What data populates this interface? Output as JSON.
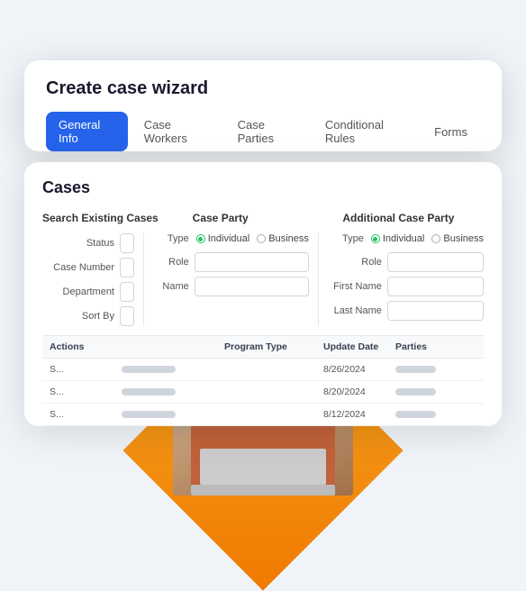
{
  "wizard": {
    "title": "Create case wizard",
    "tabs": [
      {
        "id": "general-info",
        "label": "General Info",
        "active": true
      },
      {
        "id": "case-workers",
        "label": "Case Workers",
        "active": false
      },
      {
        "id": "case-parties",
        "label": "Case Parties",
        "active": false
      },
      {
        "id": "conditional-rules",
        "label": "Conditional Rules",
        "active": false
      },
      {
        "id": "forms",
        "label": "Forms",
        "active": false
      }
    ]
  },
  "cases": {
    "title": "Cases",
    "sections": {
      "search": "Search Existing Cases",
      "case_party": "Case Party",
      "additional": "Additional Case Party"
    },
    "search_fields": [
      {
        "label": "Status",
        "value": ""
      },
      {
        "label": "Case Number",
        "value": ""
      },
      {
        "label": "Department",
        "value": ""
      },
      {
        "label": "Sort By",
        "value": ""
      }
    ],
    "case_party": {
      "type_label": "Type",
      "radio_individual": "Individual",
      "radio_business": "Business",
      "fields": [
        {
          "label": "Role",
          "value": ""
        },
        {
          "label": "Name",
          "value": ""
        }
      ]
    },
    "additional_case_party": {
      "type_label": "Type",
      "radio_individual": "Individual",
      "radio_business": "Business",
      "fields": [
        {
          "label": "Role",
          "value": ""
        },
        {
          "label": "First Name",
          "value": ""
        },
        {
          "label": "Last Name",
          "value": ""
        }
      ]
    },
    "table": {
      "headers": [
        "Actions",
        "",
        "Program Type",
        "Update Date",
        "Parties"
      ],
      "rows": [
        {
          "actions": "S...",
          "program_type": "",
          "update_date": "8/26/2024",
          "parties": ""
        },
        {
          "actions": "S...",
          "program_type": "",
          "update_date": "8/20/2024",
          "parties": ""
        },
        {
          "actions": "S...",
          "program_type": "",
          "update_date": "8/12/2024",
          "parties": ""
        }
      ]
    }
  },
  "colors": {
    "active_tab_bg": "#2563eb",
    "active_tab_text": "#ffffff",
    "inactive_tab_text": "#6b7280",
    "radio_selected": "#22c55e",
    "table_header_bg": "#f8f9fa",
    "bar_color": "#d0d5dd",
    "diamond_gradient_start": "#f5a623",
    "diamond_gradient_end": "#f07a00"
  }
}
